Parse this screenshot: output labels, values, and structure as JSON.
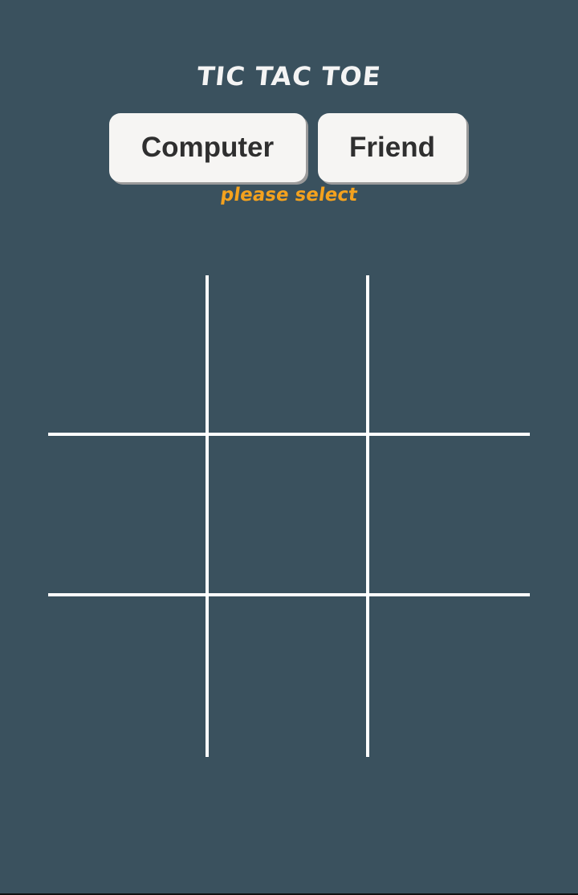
{
  "app": {
    "title": "TIC TAC TOE"
  },
  "mode_select": {
    "computer_label": "Computer",
    "friend_label": "Friend",
    "hint": "please select"
  },
  "board": {
    "cells": [
      "",
      "",
      "",
      "",
      "",
      "",
      "",
      "",
      ""
    ]
  },
  "colors": {
    "background": "#3a515e",
    "title": "#f4f4f4",
    "button_bg": "#f6f5f3",
    "button_text": "#2f2f2f",
    "hint": "#f4a21e",
    "grid_lines": "#ffffff"
  }
}
